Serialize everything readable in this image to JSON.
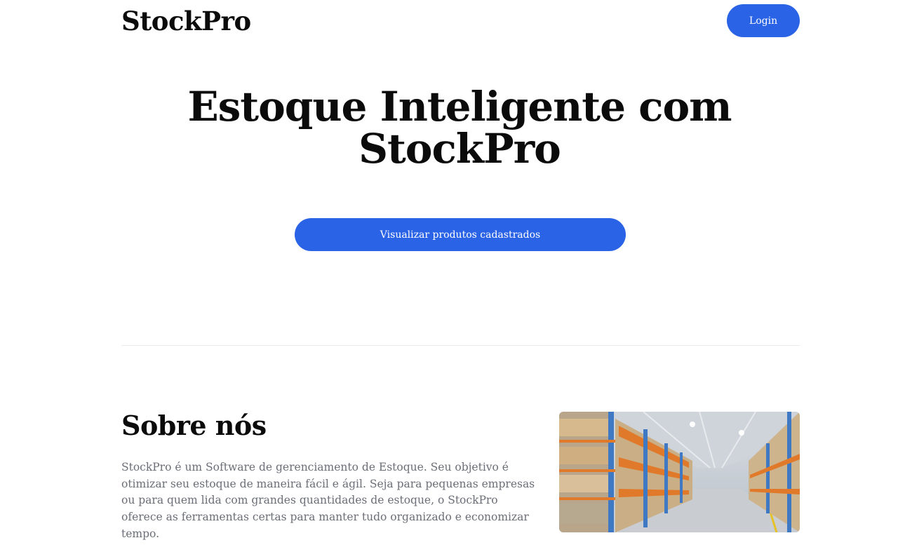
{
  "header": {
    "brand": "StockPro",
    "login_label": "Login"
  },
  "hero": {
    "title": "Estoque Inteligente com StockPro",
    "cta_label": "Visualizar produtos cadastrados"
  },
  "about": {
    "title": "Sobre nós",
    "text": "StockPro é um Software de gerenciamento de Estoque. Seu objetivo é otimizar seu estoque de maneira fácil e ágil. Seja para pequenas empresas ou para quem lida com grandes quantidades de estoque, o StockPro oferece as ferramentas certas para manter tudo organizado e economizar tempo."
  },
  "colors": {
    "accent": "#2b63e6",
    "muted_text": "#6b6e76",
    "divider": "#e9eaee"
  }
}
